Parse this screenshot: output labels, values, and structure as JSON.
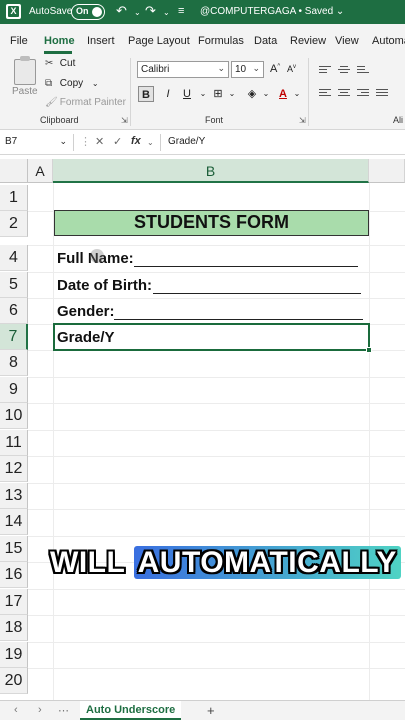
{
  "titlebar": {
    "autosave_label": "AutoSave",
    "autosave_state": "On",
    "doc_title": "@COMPUTERGAGA • Saved ⌄",
    "accent": "#1e6e42"
  },
  "tabs": [
    "File",
    "Home",
    "Insert",
    "Page Layout",
    "Formulas",
    "Data",
    "Review",
    "View",
    "Automa"
  ],
  "active_tab": "Home",
  "ribbon": {
    "paste_label": "Paste",
    "cut_label": "Cut",
    "copy_label": "Copy",
    "format_painter_label": "Format Painter",
    "clipboard_group": "Clipboard",
    "font_name": "Calibri",
    "font_size": "10",
    "bold": "B",
    "italic": "I",
    "underline": "U",
    "font_group": "Font",
    "alignment_group": "Ali"
  },
  "formula_bar": {
    "name_box": "B7",
    "formula_value": "Grade/Y",
    "fx": "fx"
  },
  "grid": {
    "columns": [
      "A",
      "B"
    ],
    "selected_column": "B",
    "rows": [
      "1",
      "2",
      "4",
      "5",
      "6",
      "7",
      "8",
      "9",
      "10",
      "11",
      "12",
      "13",
      "14",
      "15",
      "16",
      "17",
      "18",
      "19",
      "20"
    ],
    "selected_row": "7",
    "title": "STUDENTS FORM",
    "title_fill": "#a9dcab",
    "fields": {
      "full_name": "Full Name:",
      "dob": "Date of Birth:",
      "gender": "Gender:",
      "grade": "Grade/Y"
    }
  },
  "caption": {
    "word1": "WILL",
    "word2": "AUTOMATICALLY"
  },
  "sheetbar": {
    "sheet_name": "Auto Underscore",
    "add_label": "+"
  }
}
